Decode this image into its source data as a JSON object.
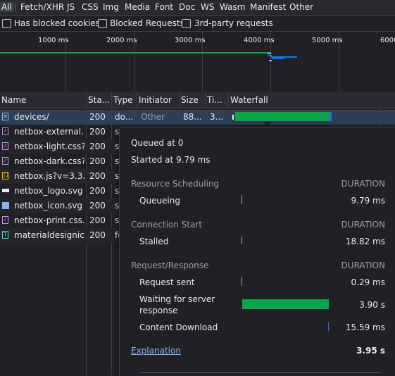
{
  "filter_bar": {
    "tabs": [
      "All",
      "Fetch/XHR",
      "JS",
      "CSS",
      "Img",
      "Media",
      "Font",
      "Doc",
      "WS",
      "Wasm",
      "Manifest",
      "Other"
    ]
  },
  "checkboxes": {
    "blocked_cookies": "Has blocked cookies",
    "blocked_requests": "Blocked Requests",
    "third_party": "3rd-party requests"
  },
  "overview": {
    "ticks": [
      "1000 ms",
      "2000 ms",
      "3000 ms",
      "4000 ms",
      "5000 ms",
      "6000"
    ]
  },
  "table": {
    "headers": {
      "name": "Name",
      "status": "Sta...",
      "type": "Type",
      "initiator": "Initiator",
      "size": "Size",
      "time": "Ti...",
      "waterfall": "Waterfall"
    },
    "rows": [
      {
        "name": "devices/",
        "status": "200",
        "type": "do...",
        "initiator": "Other",
        "size": "88...",
        "time": "3...",
        "icon": "document-icon"
      },
      {
        "name": "netbox-external....",
        "status": "200",
        "type": "s",
        "icon": "stylesheet-icon"
      },
      {
        "name": "netbox-light.css?...",
        "status": "200",
        "type": "s",
        "icon": "stylesheet-icon"
      },
      {
        "name": "netbox-dark.css?...",
        "status": "200",
        "type": "s",
        "icon": "stylesheet-icon"
      },
      {
        "name": "netbox.js?v=3.3.5",
        "status": "200",
        "type": "s",
        "icon": "script-icon"
      },
      {
        "name": "netbox_logo.svg",
        "status": "200",
        "type": "s",
        "icon": "image-icon"
      },
      {
        "name": "netbox_icon.svg",
        "status": "200",
        "type": "s",
        "icon": "image-icon"
      },
      {
        "name": "netbox-print.css...",
        "status": "200",
        "type": "s",
        "icon": "stylesheet-icon"
      },
      {
        "name": "materialdesignic...",
        "status": "200",
        "type": "fo",
        "icon": "font-icon"
      }
    ]
  },
  "timing": {
    "queued": "Queued at 0",
    "started": "Started at 9.79 ms",
    "sections": [
      {
        "title": "Resource Scheduling",
        "duration_label": "DURATION",
        "items": [
          {
            "label": "Queueing",
            "value": "9.79 ms"
          }
        ]
      },
      {
        "title": "Connection Start",
        "duration_label": "DURATION",
        "items": [
          {
            "label": "Stalled",
            "value": "18.82 ms"
          }
        ]
      },
      {
        "title": "Request/Response",
        "duration_label": "DURATION",
        "items": [
          {
            "label": "Request sent",
            "value": "0.29 ms"
          },
          {
            "label": "Waiting for server",
            "label2": "response",
            "value": "3.90 s"
          },
          {
            "label": "Content Download",
            "value": "15.59 ms"
          }
        ]
      }
    ],
    "explanation": "Explanation",
    "total": "3.95 s"
  },
  "colors": {
    "waiting": "#0ca34a",
    "download": "#1a73e8",
    "link": "#8ab4f8"
  }
}
